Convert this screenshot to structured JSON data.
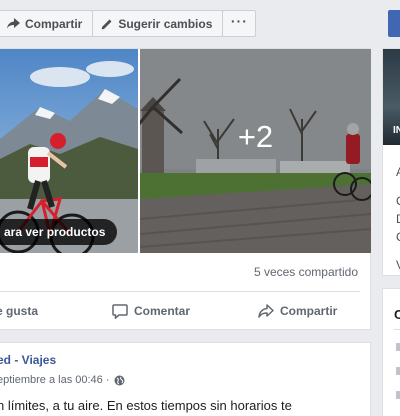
{
  "toolbar": {
    "share_label": "Compartir",
    "suggest_label": "Sugerir cambios",
    "more_label": "···"
  },
  "post": {
    "products_label": "ara ver productos",
    "more_photos": "+2",
    "shares": "5 veces compartido",
    "actions": {
      "like": "e gusta",
      "comment": "Comentar",
      "share": "Compartir"
    }
  },
  "post2": {
    "author": "ed - Viajes",
    "date": "eptiembre a las 00:46 ·",
    "text": "n límites, a tu aire. En estos tiempos sin horarios te"
  },
  "right_column": {
    "thumb_letters": "IN",
    "letters": [
      "A",
      "C",
      "D",
      "C",
      "V"
    ],
    "card2_title": "C"
  },
  "colors": {
    "brand_blue": "#4267b2",
    "link_blue": "#385898",
    "background": "#e9ebee"
  }
}
